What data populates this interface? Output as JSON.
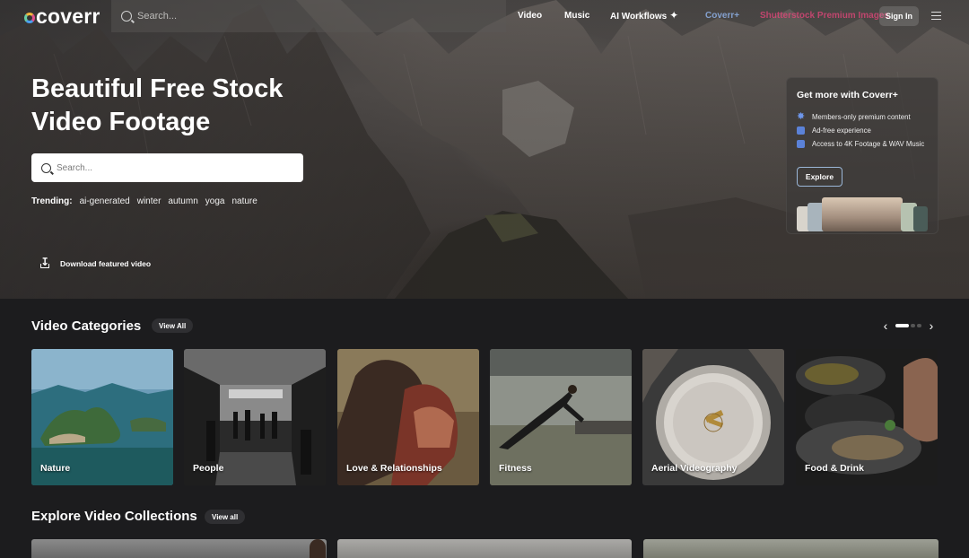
{
  "nav": {
    "logo_text": "coverr",
    "search_placeholder": "Search...",
    "links": [
      {
        "label": "Video"
      },
      {
        "label": "Music"
      },
      {
        "label": "AI Workflows"
      },
      {
        "label": "Coverr+"
      },
      {
        "label": "Shutterstock Premium Images"
      }
    ],
    "sign_in": "Sign In",
    "colors": {
      "coverr_plus": "#8fb2e8",
      "shutterstock": "#e8467c"
    }
  },
  "hero": {
    "title": "Beautiful Free Stock Video Footage",
    "search_placeholder": "Search...",
    "trending_label": "Trending:",
    "trending": [
      "ai-generated",
      "winter",
      "autumn",
      "yoga",
      "nature"
    ],
    "download_label": "Download featured video"
  },
  "promo": {
    "title": "Get more with Coverr+",
    "features": [
      {
        "text": "Members-only premium content",
        "icon": "star-burst-icon"
      },
      {
        "text": "Ad-free experience",
        "icon": "no-ads-icon"
      },
      {
        "text": "Access to 4K Footage & WAV Music",
        "icon": "4k-icon"
      }
    ],
    "explore": "Explore"
  },
  "categories": {
    "title": "Video Categories",
    "view_all": "View All",
    "items": [
      {
        "label": "Nature"
      },
      {
        "label": "People"
      },
      {
        "label": "Love & Relationships"
      },
      {
        "label": "Fitness"
      },
      {
        "label": "Aerial Videography"
      },
      {
        "label": "Food & Drink"
      }
    ],
    "pagination": {
      "pages": 3,
      "active": 1
    }
  },
  "collections": {
    "title": "Explore Video Collections",
    "view_all": "View all"
  }
}
